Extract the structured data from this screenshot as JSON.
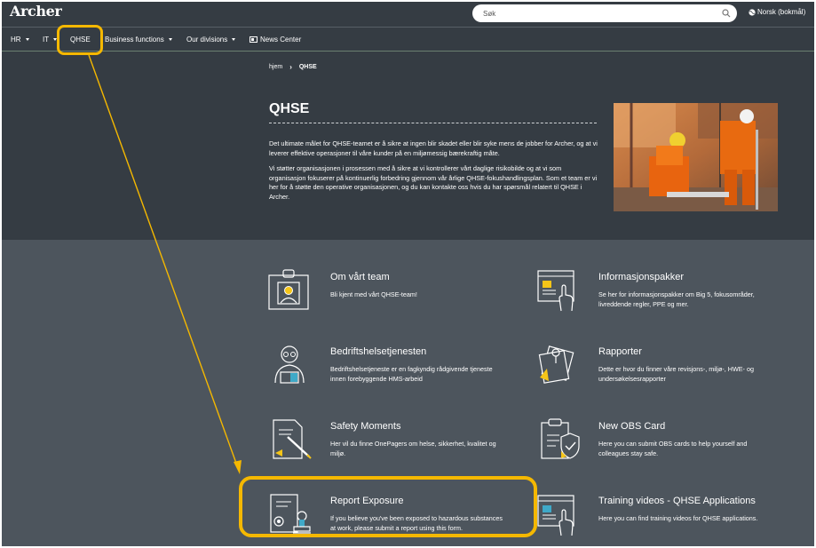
{
  "header": {
    "logo": "Archer",
    "search_placeholder": "Søk",
    "language": "Norsk (bokmål)"
  },
  "nav": {
    "items": [
      "HR",
      "IT",
      "QHSE",
      "Business functions",
      "Our divisions",
      "News Center"
    ]
  },
  "breadcrumb": {
    "home": "hjem",
    "current": "QHSE"
  },
  "hero": {
    "title": "QHSE",
    "p1": "Det ultimate målet for QHSE-teamet er å sikre at ingen blir skadet eller blir syke mens de jobber for Archer, og at vi leverer effektive operasjoner til våre kunder på en miljømessig bærekraftig måte.",
    "p2": "Vi støtter organisasjonen i prosessen med å sikre at vi kontrollerer vårt daglige risikobilde og at vi som organisasjon fokuserer på kontinuerlig forbedring gjennom vår årlige QHSE-fokushandlingsplan. Som et team er vi her for å støtte den operative organisasjonen, og du kan kontakte oss hvis du har spørsmål relatert til QHSE i Archer."
  },
  "cards": [
    {
      "title": "Om vårt team",
      "desc": "Bli kjent med vårt QHSE-team!",
      "icon": "team-badge-icon"
    },
    {
      "title": "Informasjonspakker",
      "desc": "Se her for informasjonspakker om Big 5, fokusområder, livreddende regler, PPE og mer.",
      "icon": "info-screen-icon"
    },
    {
      "title": "Bedriftshelsetjenesten",
      "desc": "Bedriftshelsetjeneste er en fagkyndig rådgivende tjeneste innen forebyggende HMS-arbeid",
      "icon": "doctor-reading-icon"
    },
    {
      "title": "Rapporter",
      "desc": "Dette er hvor du finner våre revisjons-, miljø-, HWE- og undersøkelsesrapporter",
      "icon": "reports-pin-icon"
    },
    {
      "title": "Safety Moments",
      "desc": "Her vil du finne OnePagers om helse, sikkerhet, kvalitet og miljø.",
      "icon": "document-pen-icon"
    },
    {
      "title": "New OBS Card",
      "desc": "Here you can submit OBS cards to help yourself and colleagues stay safe.",
      "icon": "clipboard-check-icon"
    },
    {
      "title": "Report Exposure",
      "desc": "If you believe you've been exposed to hazardous substances at work, please submit a report using this form.",
      "icon": "document-stamp-icon"
    },
    {
      "title": "Training videos - QHSE Applications",
      "desc": "Here you can find training videos for QHSE applications.",
      "icon": "video-screen-icon"
    }
  ],
  "colors": {
    "highlight": "#f5b800",
    "accent": "#f5c518",
    "dark_band": "#353c43",
    "content_bg": "#4d555d"
  }
}
